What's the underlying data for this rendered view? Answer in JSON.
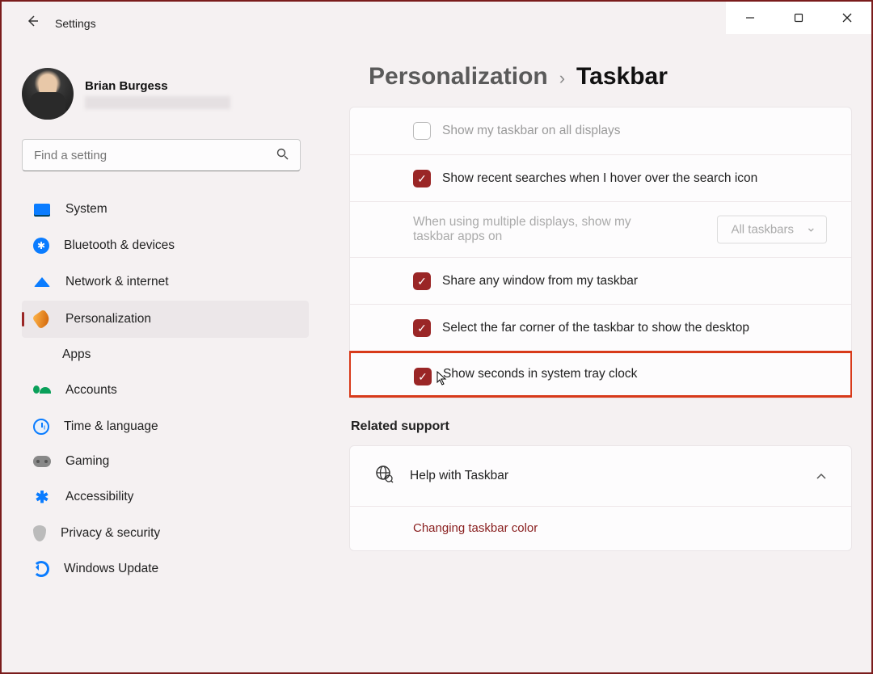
{
  "window": {
    "app_title": "Settings"
  },
  "profile": {
    "name": "Brian Burgess"
  },
  "search": {
    "placeholder": "Find a setting"
  },
  "nav": {
    "items": [
      {
        "label": "System"
      },
      {
        "label": "Bluetooth & devices"
      },
      {
        "label": "Network & internet"
      },
      {
        "label": "Personalization"
      },
      {
        "label": "Apps"
      },
      {
        "label": "Accounts"
      },
      {
        "label": "Time & language"
      },
      {
        "label": "Gaming"
      },
      {
        "label": "Accessibility"
      },
      {
        "label": "Privacy & security"
      },
      {
        "label": "Windows Update"
      }
    ]
  },
  "breadcrumb": {
    "parent": "Personalization",
    "current": "Taskbar"
  },
  "settings": {
    "show_all_displays": "Show my taskbar on all displays",
    "recent_searches": "Show recent searches when I hover over the search icon",
    "multi_display_label": "When using multiple displays, show my taskbar apps on",
    "multi_display_value": "All taskbars",
    "share_window": "Share any window from my taskbar",
    "far_corner": "Select the far corner of the taskbar to show the desktop",
    "show_seconds": "Show seconds in system tray clock"
  },
  "related": {
    "title": "Related support",
    "help_label": "Help with Taskbar",
    "link1": "Changing taskbar color"
  }
}
